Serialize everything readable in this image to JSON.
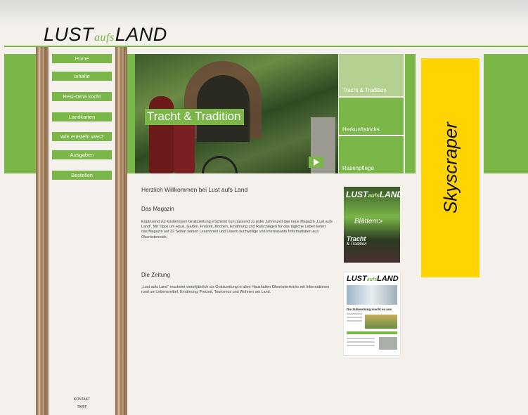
{
  "logo": {
    "part1": "LUST",
    "part2": "aufs",
    "part3": "LAND"
  },
  "nav": {
    "items": [
      "Home",
      "Inhalte",
      "Resi-Oma kocht",
      "Landkarten",
      "Wie entsteht was?",
      "Ausgaben",
      "Bestellen"
    ],
    "footer": [
      "KONTAKT",
      "TARIF"
    ]
  },
  "hero": {
    "title": "Tracht & Tradition",
    "tabs": [
      "Tracht & Tradition",
      "Herkunftstricks",
      "Rasenpflege"
    ]
  },
  "ad": {
    "label": "Skyscraper"
  },
  "content": {
    "welcome": "Herzlich Willkommen bei Lust aufs Land",
    "section1_title": "Das Magazin",
    "section1_text": "Ergänzend zur kostenlosen Gratiszeitung erscheint nun passend zu jeder Jahreszeit das neue Magazin „Lust aufs Land“. Mit Tipps um Haus, Garten, Freizeit, Kochen, Ernährung und Ratschlägen für das tägliche Leben liefert das Magazin auf 32 Seiten seinen Leserinnen und Lesern kurzweilige und interessante Informationen aus Oberösterreich.",
    "section2_title": "Die Zeitung",
    "section2_text": "„Lust aufs Land“ erscheint vierteljährlich als Gratiszeitung in allen Haushalten Oberösterreichs mit Informationen rund um Lebensmittel, Ernährung, Freizeit, Tourismus und Wohnen am Land."
  },
  "magazine_thumb": {
    "logo1": "LUST",
    "logo2": "aufs",
    "logo3": "LAND",
    "browse": "Blättern>",
    "cover_title": "Tracht",
    "cover_sub": "& Tradition"
  },
  "newspaper_thumb": {
    "logo1": "LUST",
    "logo2": "aufs",
    "logo3": "LAND",
    "headline": "Die Zubereitung macht es aus"
  },
  "colors": {
    "green": "#7ab648",
    "yellow": "#ffd400",
    "background": "#f4f1ec"
  }
}
